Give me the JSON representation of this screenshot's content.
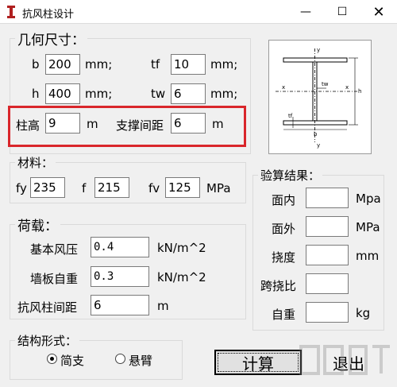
{
  "window": {
    "title": "抗风柱设计",
    "close_glyph": "✕",
    "min_glyph": "—",
    "max_glyph": "☐"
  },
  "geometry": {
    "legend": "几何尺寸：",
    "b": {
      "label": "b",
      "value": "200",
      "unit": "mm;"
    },
    "tf": {
      "label": "tf",
      "value": "10",
      "unit": "mm;"
    },
    "h": {
      "label": "h",
      "value": "400",
      "unit": "mm;"
    },
    "tw": {
      "label": "tw",
      "value": "6",
      "unit": "mm;"
    },
    "col_height": {
      "label": "柱高",
      "value": "9",
      "unit": "m"
    },
    "brace_spacing": {
      "label": "支撑间距",
      "value": "6",
      "unit": "m"
    }
  },
  "diagram": {
    "y_top": "y",
    "y_bottom": "y",
    "x_left": "x",
    "x_right": "x",
    "tw": "tw",
    "tf": "tf",
    "b": "b",
    "h": "h"
  },
  "material": {
    "legend": "材料：",
    "fy": {
      "label": "fy",
      "value": "235"
    },
    "f": {
      "label": "f",
      "value": "215"
    },
    "fv": {
      "label": "fv",
      "value": "125",
      "unit": "MPa"
    }
  },
  "loads": {
    "legend": "荷载：",
    "wind": {
      "label": "基本风压",
      "value": "0.4",
      "unit": "kN/m^2"
    },
    "wall": {
      "label": "墙板自重",
      "value": "0.3",
      "unit": "kN/m^2"
    },
    "spacing": {
      "label": "抗风柱间距",
      "value": "6",
      "unit": "m"
    }
  },
  "results": {
    "legend": "验算结果：",
    "in_plane": {
      "label": "面内",
      "value": "",
      "unit": "Mpa"
    },
    "out_plane": {
      "label": "面外",
      "value": "",
      "unit": "MPa"
    },
    "deflection": {
      "label": "挠度",
      "value": "",
      "unit": "mm"
    },
    "span_ratio": {
      "label": "跨挠比",
      "value": ""
    },
    "self_weight": {
      "label": "自重",
      "value": "",
      "unit": "kg"
    }
  },
  "structure": {
    "legend": "结构形式：",
    "simple": "简支",
    "cantilever": "悬臂",
    "selected": "simple"
  },
  "buttons": {
    "calc": "计算",
    "exit": "退出"
  }
}
